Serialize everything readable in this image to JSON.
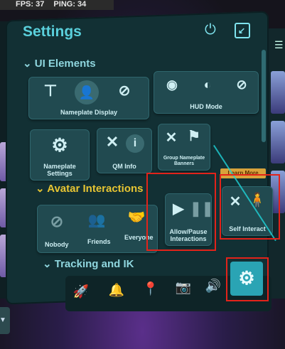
{
  "hud": {
    "fps": "FPS: 37",
    "ping": "PING: 34"
  },
  "panel": {
    "title": "Settings"
  },
  "sections": {
    "ui_elements": "UI Elements",
    "avatar_interactions": "Avatar Interactions",
    "tracking": "Tracking and IK"
  },
  "tiles": {
    "nameplate_display": "Nameplate Display",
    "hud_mode": "HUD Mode",
    "nameplate_settings": "Nameplate Settings",
    "qm_info": "QM Info",
    "group_nameplate_banners": "Group Nameplate Banners",
    "nobody": "Nobody",
    "friends": "Friends",
    "everyone": "Everyone",
    "allow_pause": "Allow/Pause Interactions",
    "self_interact": "Self Interact"
  },
  "learn_more": "Learn More",
  "colors": {
    "accent": "#5ad0dc",
    "highlight": "#e2231a",
    "section_yellow": "#e7c533"
  }
}
